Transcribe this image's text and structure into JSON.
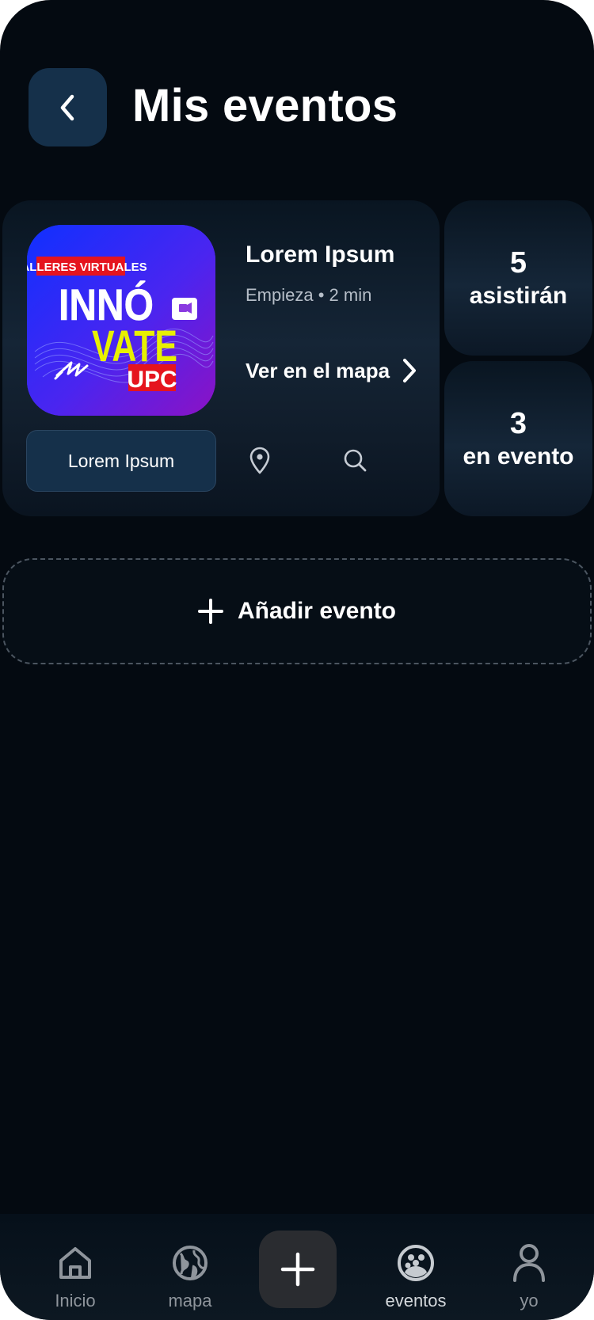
{
  "header": {
    "back_icon": "chevron-left-icon",
    "title": "Mis eventos"
  },
  "event": {
    "poster": {
      "banner": "TALLERES VIRTUALES",
      "line1": "INNÓ",
      "line2": "VATE",
      "line3": "UPC"
    },
    "title": "Lorem Ipsum",
    "meta": "Empieza • 2 min",
    "map_link_label": "Ver en el mapa",
    "button_label": "Lorem Ipsum",
    "icons": [
      "map-pin-icon",
      "search-icon"
    ]
  },
  "stats": [
    {
      "number": "5",
      "label": "asistirán"
    },
    {
      "number": "3",
      "label": "en evento"
    }
  ],
  "add_event": {
    "label": "Añadir evento",
    "icon": "plus-icon"
  },
  "nav": {
    "items": [
      {
        "label": "Inicio",
        "icon": "home-icon"
      },
      {
        "label": "mapa",
        "icon": "globe-icon"
      },
      {
        "label": "eventos",
        "icon": "group-icon",
        "active": true
      },
      {
        "label": "yo",
        "icon": "user-icon"
      }
    ],
    "center_icon": "plus-icon"
  },
  "colors": {
    "background": "#040a11",
    "card": "#152536",
    "button": "#15304a",
    "poster_yellow": "#e8f000",
    "poster_red": "#e5141e"
  }
}
